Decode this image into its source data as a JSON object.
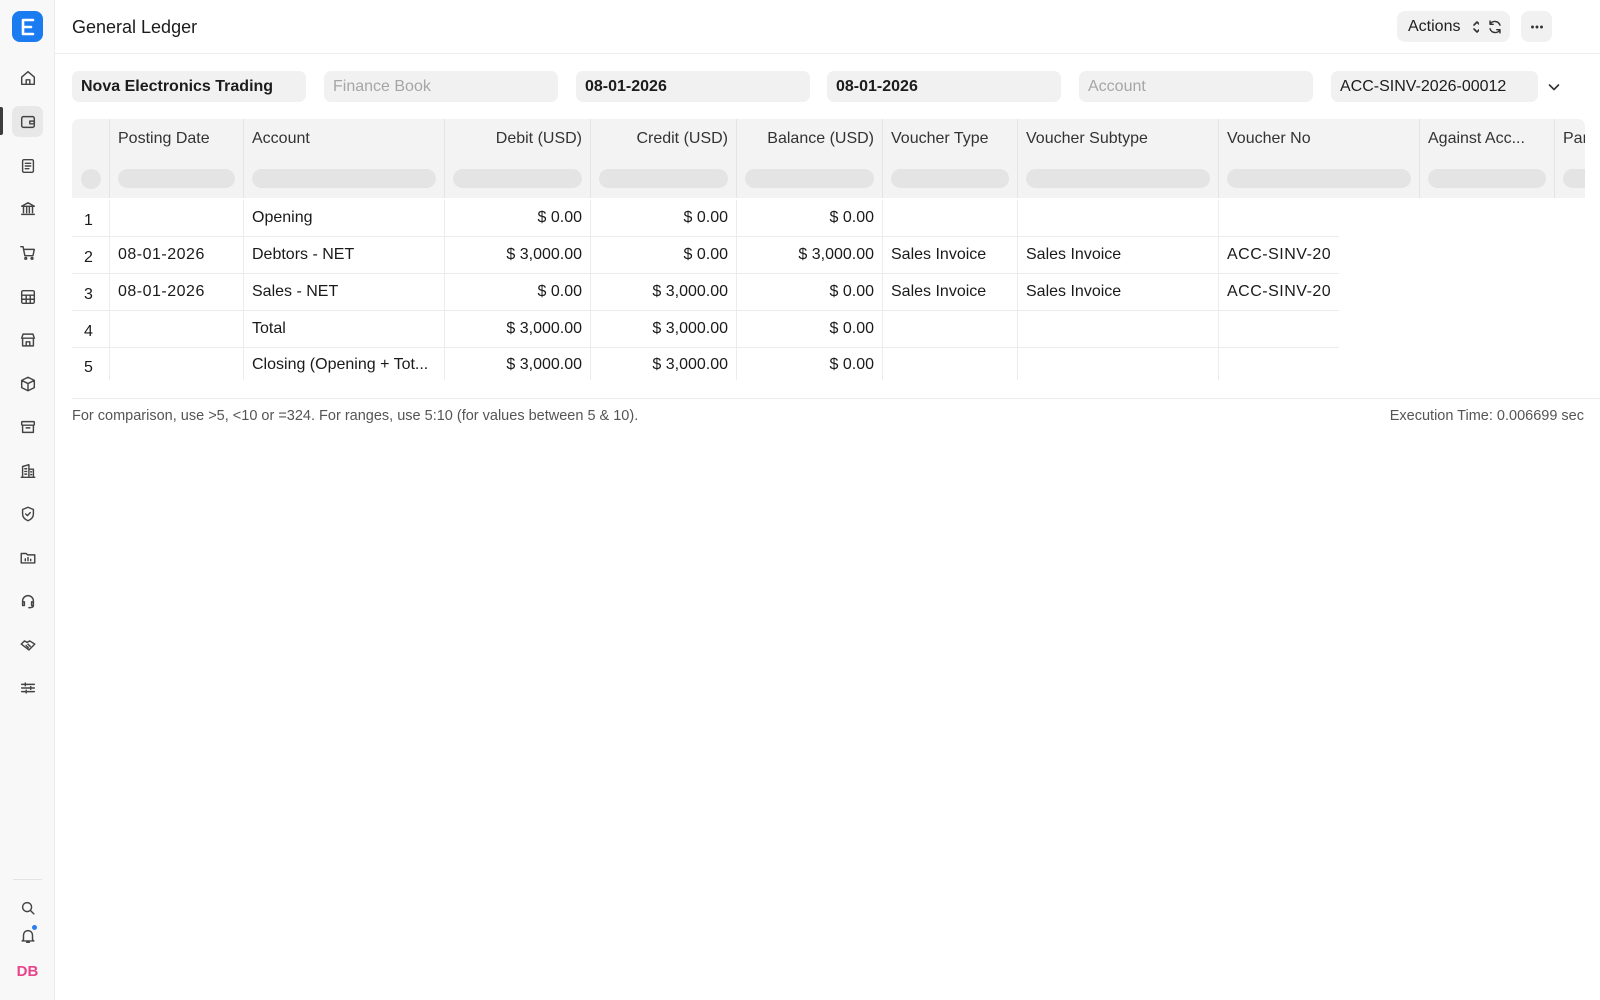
{
  "app": {
    "logo_letter": "E",
    "user_initials": "DB"
  },
  "sidebar": {
    "items": [
      {
        "icon": "home-icon"
      },
      {
        "icon": "wallet-icon",
        "active": true
      },
      {
        "icon": "document-icon"
      },
      {
        "icon": "bank-icon"
      },
      {
        "icon": "cart-icon"
      },
      {
        "icon": "table-icon"
      },
      {
        "icon": "store-icon"
      },
      {
        "icon": "box-icon"
      },
      {
        "icon": "archive-icon"
      },
      {
        "icon": "building-icon"
      },
      {
        "icon": "shield-icon"
      },
      {
        "icon": "folder-chart-icon"
      },
      {
        "icon": "headset-icon"
      },
      {
        "icon": "handshake-icon"
      },
      {
        "icon": "sliders-icon"
      }
    ],
    "bottom": [
      {
        "icon": "search-icon"
      },
      {
        "icon": "bell-icon",
        "has_notification": true
      }
    ]
  },
  "header": {
    "title": "General Ledger",
    "actions_label": "Actions"
  },
  "filters": {
    "company": "Nova Electronics Trading",
    "finance_book_placeholder": "Finance Book",
    "from_date": "08-01-2026",
    "to_date": "08-01-2026",
    "account_placeholder": "Account",
    "voucher_no": "ACC-SINV-2026-00012"
  },
  "table": {
    "columns": [
      "Posting Date",
      "Account",
      "Debit (USD)",
      "Credit (USD)",
      "Balance (USD)",
      "Voucher Type",
      "Voucher Subtype",
      "Voucher No",
      "Against Acc...",
      "Par"
    ],
    "rows": [
      {
        "idx": "1",
        "posting_date": "",
        "account": "Opening",
        "debit": "$ 0.00",
        "credit": "$ 0.00",
        "balance": "$ 0.00",
        "voucher_type": "",
        "voucher_subtype": "",
        "voucher_no": ""
      },
      {
        "idx": "2",
        "posting_date": "08-01-2026",
        "account": "Debtors - NET",
        "debit": "$ 3,000.00",
        "credit": "$ 0.00",
        "balance": "$ 3,000.00",
        "voucher_type": "Sales Invoice",
        "voucher_subtype": "Sales Invoice",
        "voucher_no": "ACC-SINV-20"
      },
      {
        "idx": "3",
        "posting_date": "08-01-2026",
        "account": "Sales - NET",
        "debit": "$ 0.00",
        "credit": "$ 3,000.00",
        "balance": "$ 0.00",
        "voucher_type": "Sales Invoice",
        "voucher_subtype": "Sales Invoice",
        "voucher_no": "ACC-SINV-20"
      },
      {
        "idx": "4",
        "posting_date": "",
        "account": "Total",
        "debit": "$ 3,000.00",
        "credit": "$ 3,000.00",
        "balance": "$ 0.00",
        "voucher_type": "",
        "voucher_subtype": "",
        "voucher_no": ""
      },
      {
        "idx": "5",
        "posting_date": "",
        "account": "Closing (Opening + Tot...",
        "debit": "$ 3,000.00",
        "credit": "$ 3,000.00",
        "balance": "$ 0.00",
        "voucher_type": "",
        "voucher_subtype": "",
        "voucher_no": ""
      }
    ]
  },
  "footer": {
    "note": "For comparison, use >5, <10 or =324. For ranges, use 5:10 (for values between 5 & 10).",
    "execution_time": "Execution Time: 0.006699 sec"
  }
}
